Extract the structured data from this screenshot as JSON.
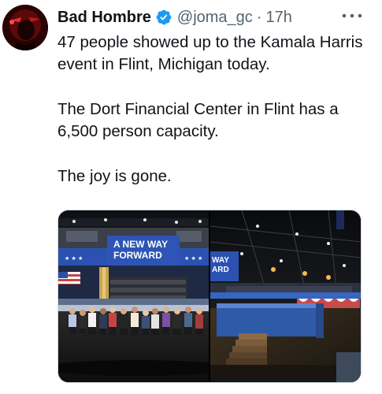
{
  "author": {
    "display_name": "Bad Hombre",
    "handle": "@joma_gc",
    "separator": "·",
    "time": "17h",
    "verified": true,
    "verified_color": "#1d9bf0",
    "avatar_icon": "profile-avatar"
  },
  "tweet": {
    "paragraphs": [
      "47 people showed up to the Kamala Harris event in Flint, Michigan today.",
      "The Dort Financial Center in Flint has a 6,500 person capacity.",
      "The joy is gone."
    ]
  },
  "media": {
    "left_banner": {
      "line1": "A NEW WAY",
      "line2": "FORWARD"
    },
    "right_banner": {
      "line1": "WAY",
      "line2": "ARD"
    }
  },
  "icons": {
    "more": "more-horizontal-icon",
    "verified": "verified-badge-icon"
  }
}
